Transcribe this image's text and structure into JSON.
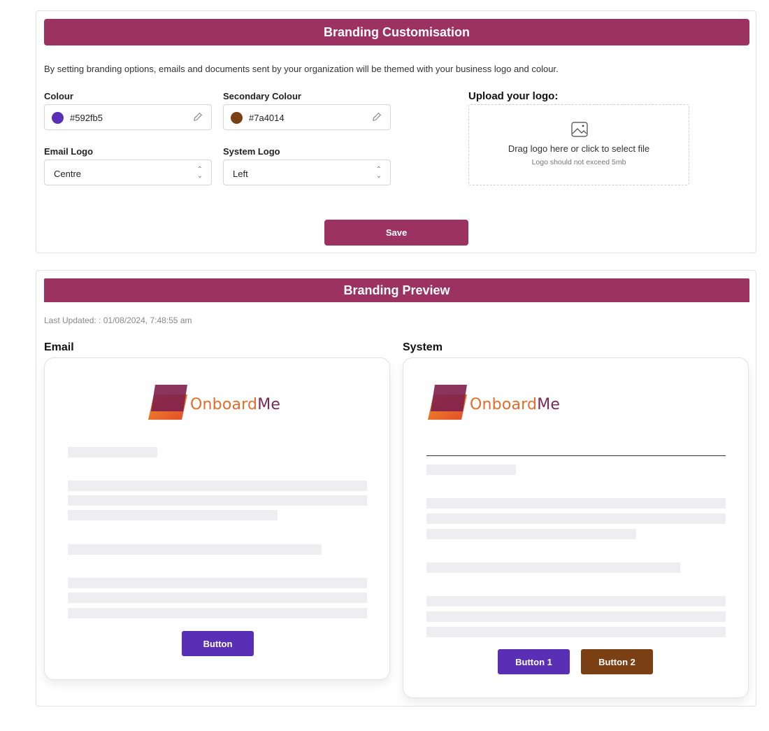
{
  "customisation": {
    "title": "Branding Customisation",
    "intro": "By setting branding options, emails and documents sent by your organization will be themed with your business logo and colour.",
    "colour": {
      "label": "Colour",
      "value": "#592fb5",
      "swatch": "#592fb5"
    },
    "secondary_colour": {
      "label": "Secondary Colour",
      "value": "#7a4014",
      "swatch": "#7a4014"
    },
    "email_logo": {
      "label": "Email Logo",
      "value": "Centre"
    },
    "system_logo": {
      "label": "System Logo",
      "value": "Left"
    },
    "upload": {
      "title": "Upload your logo:",
      "instruction": "Drag logo here or click to select file",
      "limit": "Logo should not exceed 5mb",
      "icon": "image-icon"
    },
    "save_label": "Save"
  },
  "preview": {
    "title": "Branding Preview",
    "last_updated": "Last Updated: : 01/08/2024, 7:48:55 am",
    "email": {
      "heading": "Email",
      "logo_text_a": "Onboard",
      "logo_text_b": "Me",
      "button_label": "Button"
    },
    "system": {
      "heading": "System",
      "logo_text_a": "Onboard",
      "logo_text_b": "Me",
      "button1_label": "Button 1",
      "button2_label": "Button 2"
    }
  },
  "colors": {
    "brand_bar": "#9b3262",
    "primary": "#592fb5",
    "secondary": "#7a4014"
  }
}
